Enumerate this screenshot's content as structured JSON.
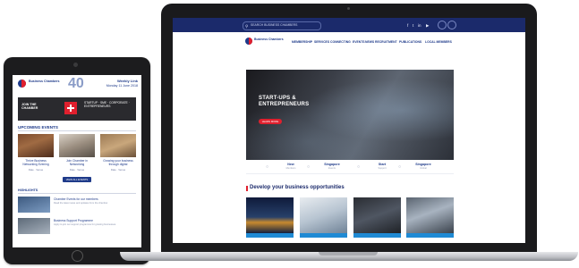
{
  "tablet": {
    "brand": "Business Chambers",
    "anniversary": "40",
    "weekly_title": "Weekly Link",
    "date": "Monday 11 June 2018",
    "banner_title": "JOIN THE CHAMBER",
    "banner_copy": "STARTUP · SME · CORPORATE · ENTREPRENEURS",
    "upcoming_heading": "UPCOMING EVENTS",
    "events": [
      {
        "title": "Thrive Business Networking Evening",
        "meta": "Date · Venue"
      },
      {
        "title": "Join Chamber in Networking",
        "meta": "Date · Venue"
      },
      {
        "title": "Growing your business through digital",
        "meta": "Date · Venue"
      }
    ],
    "view_all_label": "VIEW ALL EVENTS",
    "highlights_heading": "HIGHLIGHTS",
    "highlights": [
      {
        "title": "Chamber Events for our members",
        "body": "Read the latest news and updates from the chamber."
      },
      {
        "title": "Business Support Programme",
        "body": "Apply to join our support programme for growing businesses."
      }
    ]
  },
  "laptop": {
    "topbar": {
      "search_placeholder": "SEARCH BUSINESS CHAMBERS",
      "social": [
        "f",
        "t",
        "in",
        "▶"
      ]
    },
    "site_brand": "Business Chambers",
    "menu": [
      "MEMBERSHIP",
      "SERVICES",
      "CONNECTING",
      "EVENTS",
      "NEWS",
      "RECRUITMENT",
      "PUBLICATIONS",
      "LOCAL MEMBERS"
    ],
    "hero": {
      "title": "START-UPS & ENTREPRENEURS",
      "button": "LEARN MORE"
    },
    "stats": [
      {
        "value": "New",
        "label": "Members"
      },
      {
        "value": "Singapore",
        "label": "Events"
      },
      {
        "value": "Start",
        "label": "Support"
      },
      {
        "value": "Singapore",
        "label": "Global"
      }
    ],
    "section_heading": "Develop your business opportunities"
  },
  "colors": {
    "navy": "#1b2a6b",
    "brand_blue": "#1f3b8a",
    "accent_red": "#e0202e",
    "card_blue": "#1f8ad4"
  }
}
